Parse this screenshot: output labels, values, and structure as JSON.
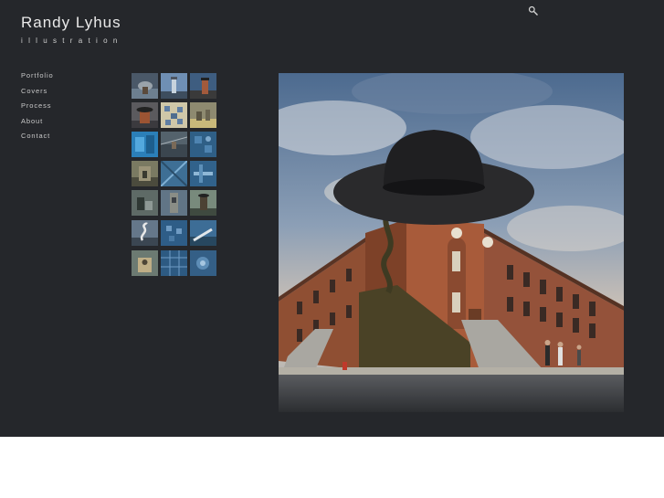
{
  "site": {
    "title": "Randy Lyhus",
    "subtitle": "illustration"
  },
  "header": {
    "search_icon": "search-icon"
  },
  "nav": {
    "items": [
      {
        "label": "Portfolio"
      },
      {
        "label": "Covers"
      },
      {
        "label": "Process"
      },
      {
        "label": "About"
      },
      {
        "label": "Contact"
      }
    ]
  },
  "thumbnails": {
    "count": 21,
    "columns": 3
  },
  "colors": {
    "background": "#25272b",
    "page": "#ffffff",
    "title_text": "#e9e9e9",
    "nav_text": "#c9c9c9"
  }
}
